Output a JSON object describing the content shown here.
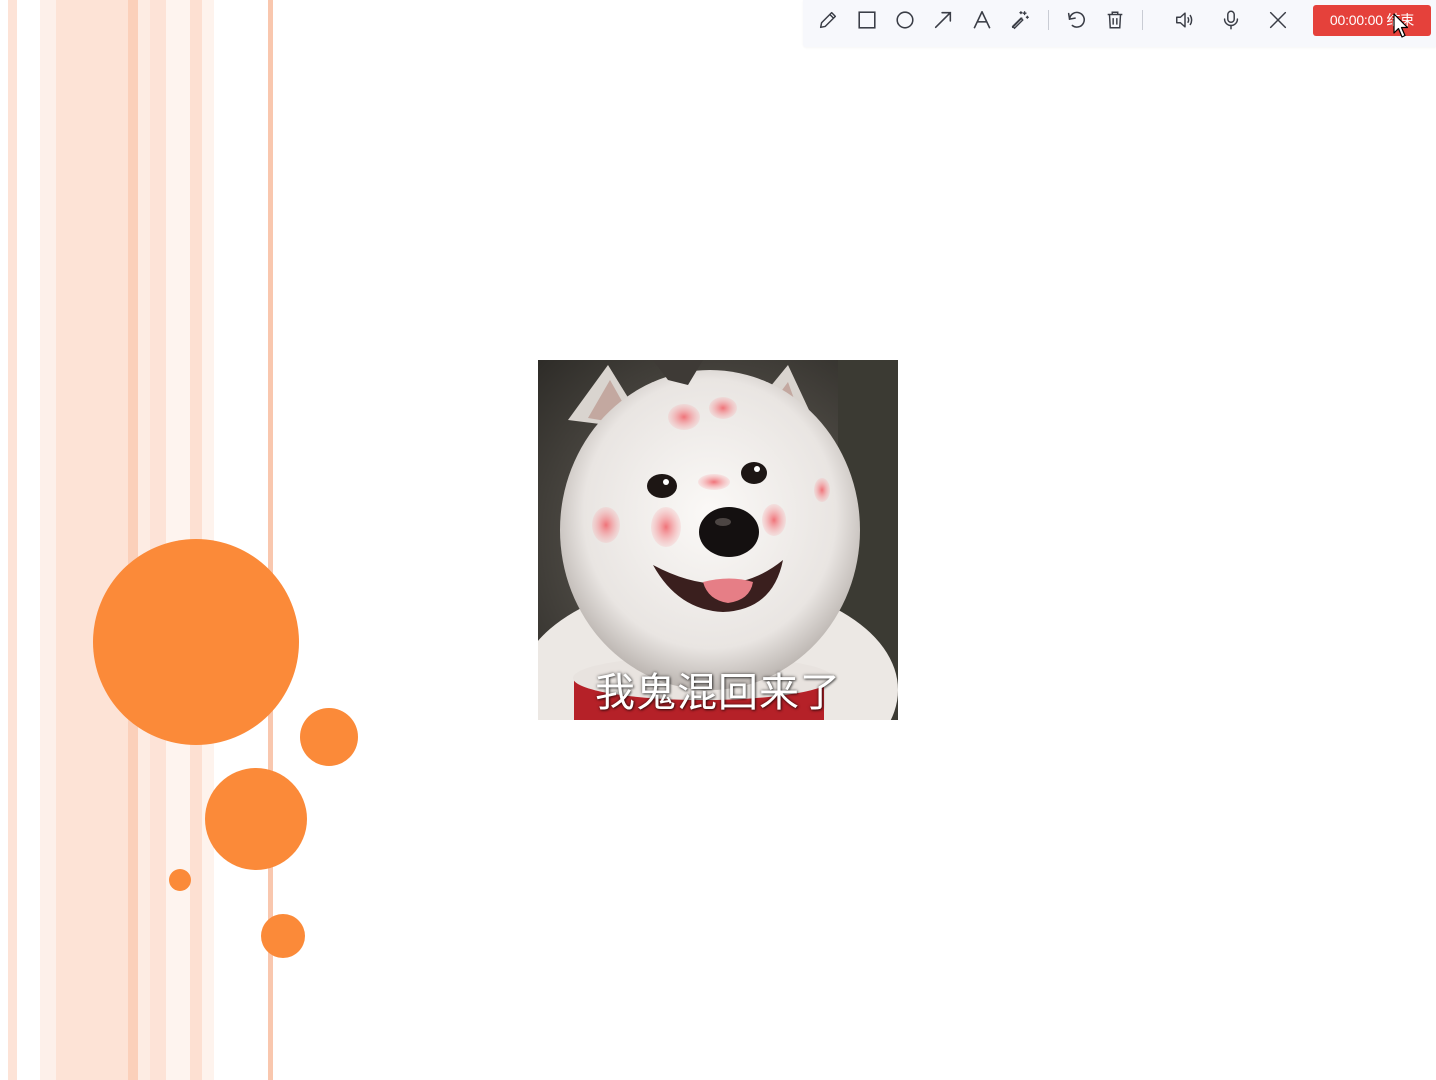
{
  "toolbar": {
    "tools": [
      {
        "icon": "pencil-icon",
        "label": "pen"
      },
      {
        "icon": "rectangle-icon",
        "label": "rectangle"
      },
      {
        "icon": "circle-icon",
        "label": "circle"
      },
      {
        "icon": "arrow-icon",
        "label": "arrow"
      },
      {
        "icon": "text-icon",
        "label": "text"
      },
      {
        "icon": "magic-wand-icon",
        "label": "effects"
      },
      {
        "icon": "undo-icon",
        "label": "undo"
      },
      {
        "icon": "trash-icon",
        "label": "clear"
      },
      {
        "icon": "speaker-icon",
        "label": "system audio"
      },
      {
        "icon": "microphone-icon",
        "label": "microphone"
      },
      {
        "icon": "close-icon",
        "label": "close"
      }
    ],
    "end_button": {
      "time": "00:00:00",
      "label": "结束",
      "color": "#e5413b"
    }
  },
  "slide": {
    "meme_caption": "我鬼混回来了",
    "accent_color": "#fb8a39",
    "stripe_color": "#f9c7ae"
  }
}
